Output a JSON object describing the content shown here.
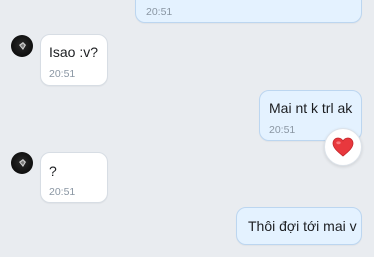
{
  "messages": [
    {
      "direction": "out",
      "text": "",
      "time": "20:51"
    },
    {
      "direction": "in",
      "text": "Isao :v?",
      "time": "20:51"
    },
    {
      "direction": "out",
      "text": "Mai nt k trl ak",
      "time": "20:51",
      "reaction": "heart-emoji"
    },
    {
      "direction": "in",
      "text": "?",
      "time": "20:51"
    },
    {
      "direction": "out",
      "text": "Thôi đợi tới mai v",
      "time": ""
    }
  ],
  "colors": {
    "background": "#e9ecf0",
    "incoming_bubble": "#ffffff",
    "outgoing_bubble": "#e4f2ff",
    "time_text": "#8a96a3",
    "heart": "#e8383d"
  }
}
